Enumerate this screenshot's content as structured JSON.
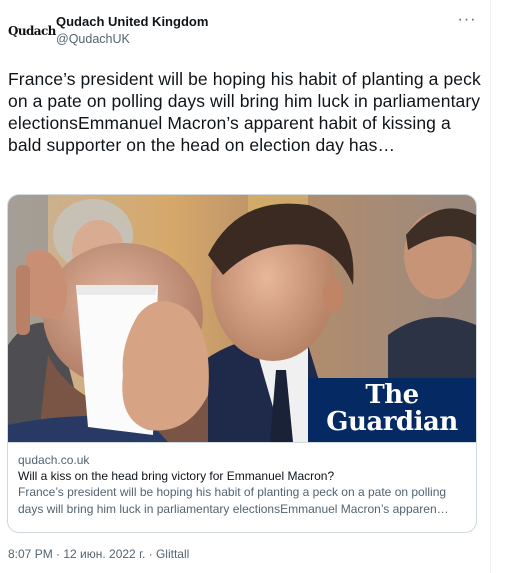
{
  "author": {
    "logo_text": "Qudach",
    "display_name": "Qudach United Kingdom",
    "handle": "@QudachUK"
  },
  "more_icon": "more-horizontal-icon",
  "tweet": {
    "text": "France’s president will be hoping his habit of planting a peck on a pate on polling days will bring him luck in parliamentary electionsEmmanuel Macron’s apparent habit of kissing a bald supporter on the head on election day has…"
  },
  "card": {
    "logo_line1": "The",
    "logo_line2": "Guardian",
    "domain": "qudach.co.uk",
    "title": "Will a kiss on the head bring victory for Emmanuel Macron?",
    "description": "France’s president will be hoping his habit of planting a peck on a pate on polling days will bring him luck in parliamentary electionsEmmanuel Macron’s apparen…"
  },
  "meta": {
    "timestamp": "8:07 PM · 12 июн. 2022 г. · Glittall"
  },
  "colors": {
    "secondary_text": "#536471",
    "border": "#cfd9de",
    "guardian_blue": "#052962"
  }
}
